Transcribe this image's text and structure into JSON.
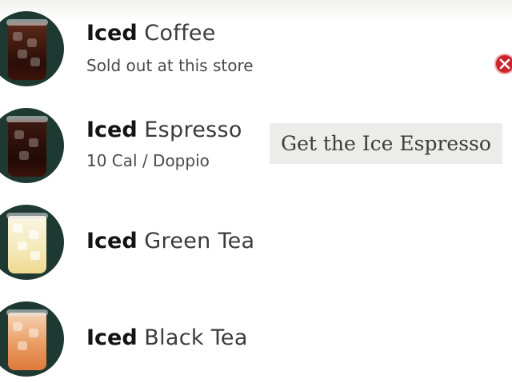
{
  "menu": {
    "items": [
      {
        "title_bold": "Iced",
        "title_rest": "Coffee",
        "subtitle": "Sold out at this store",
        "image": "iced-coffee-image"
      },
      {
        "title_bold": "Iced",
        "title_rest": "Espresso",
        "subtitle": "10 Cal / Doppio",
        "image": "iced-espresso-image"
      },
      {
        "title_bold": "Iced",
        "title_rest": "Green Tea",
        "subtitle": "",
        "image": "iced-green-tea-image"
      },
      {
        "title_bold": "Iced",
        "title_rest": "Black Tea",
        "subtitle": "",
        "image": "iced-black-tea-image"
      }
    ]
  },
  "ad_banner": {
    "text": "Get the Ice Espresso"
  },
  "icons": {
    "dismiss": "close-icon"
  },
  "colors": {
    "thumb_background": "#1e3932",
    "close_red": "#c8262c"
  }
}
